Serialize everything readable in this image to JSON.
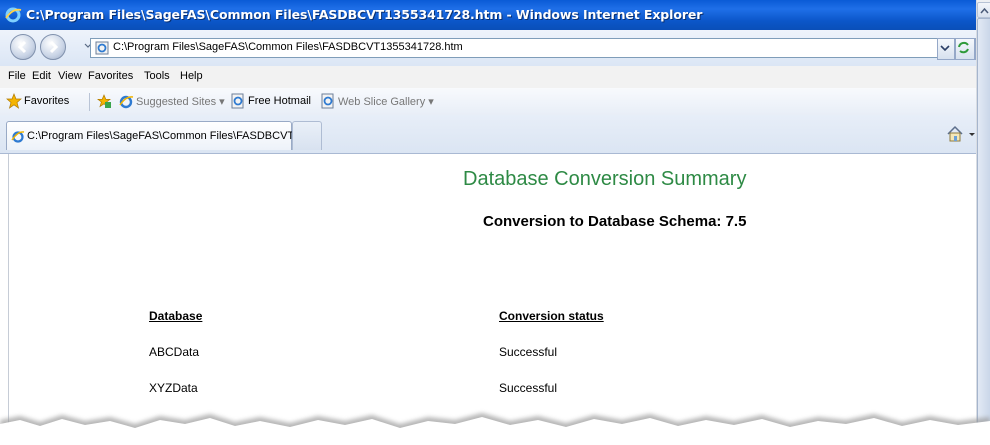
{
  "window": {
    "title": "C:\\Program Files\\SageFAS\\Common Files\\FASDBCVT1355341728.htm - Windows Internet Explorer"
  },
  "address_bar": {
    "url": "C:\\Program Files\\SageFAS\\Common Files\\FASDBCVT1355341728.htm"
  },
  "menu": {
    "items": [
      "File",
      "Edit",
      "View",
      "Favorites",
      "Tools",
      "Help"
    ]
  },
  "favorites_bar": {
    "favorites_label": "Favorites",
    "suggested_sites": "Suggested Sites ▾",
    "free_hotmail": "Free Hotmail",
    "web_slice_gallery": "Web Slice Gallery ▾"
  },
  "tabs": [
    {
      "label": "C:\\Program Files\\SageFAS\\Common Files\\FASDBCVT1..."
    }
  ],
  "page": {
    "title": "Database Conversion Summary",
    "subtitle": "Conversion to Database Schema: 7.5",
    "table": {
      "headers": [
        "Database",
        "Conversion status"
      ],
      "rows": [
        [
          "ABCData",
          "Successful"
        ],
        [
          "XYZData",
          "Successful"
        ]
      ]
    }
  },
  "colors": {
    "title_green": "#2e8a45",
    "titlebar_blue": "#0a5bd6"
  }
}
